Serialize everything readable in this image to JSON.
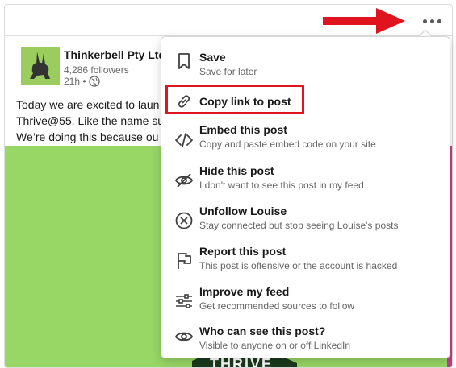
{
  "post": {
    "company_name": "Thinkerbell Pty Ltd",
    "followers": "4,286 followers",
    "time": "21h •",
    "text_lines": [
      "Today we are excited to laun",
      "Thrive@55. Like the name su",
      "We’re doing this because ou"
    ],
    "image_text": "THRIVE"
  },
  "menu": {
    "items": [
      {
        "title": "Save",
        "subtitle": "Save for later",
        "icon": "bookmark-icon"
      },
      {
        "title": "Copy link to post",
        "subtitle": "",
        "icon": "link-icon"
      },
      {
        "title": "Embed this post",
        "subtitle": "Copy and paste embed code on your site",
        "icon": "code-icon"
      },
      {
        "title": "Hide this post",
        "subtitle": "I don't want to see this post in my feed",
        "icon": "eye-slash-icon"
      },
      {
        "title": "Unfollow Louise",
        "subtitle": "Stay connected but stop seeing Louise's posts",
        "icon": "x-circle-icon"
      },
      {
        "title": "Report this post",
        "subtitle": "This post is offensive or the account is hacked",
        "icon": "flag-icon"
      },
      {
        "title": "Improve my feed",
        "subtitle": "Get recommended sources to follow",
        "icon": "sliders-icon"
      },
      {
        "title": "Who can see this post?",
        "subtitle": "Visible to anyone on or off LinkedIn",
        "icon": "eye-icon"
      }
    ]
  },
  "colors": {
    "annotation_red": "#e0141e",
    "image_green": "#98d666",
    "image_pink": "#c23e8e"
  }
}
